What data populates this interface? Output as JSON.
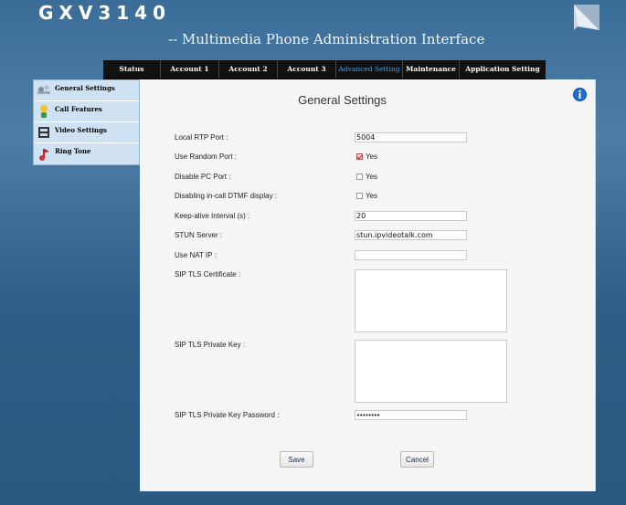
{
  "header": {
    "brand": "GXV3140",
    "subtitle": "-- Multimedia Phone Administration Interface"
  },
  "nav": {
    "tabs": [
      {
        "label": "Status",
        "active": false
      },
      {
        "label": "Account 1",
        "active": false
      },
      {
        "label": "Account 2",
        "active": false
      },
      {
        "label": "Account 3",
        "active": false
      },
      {
        "label": "Advanced Setting",
        "active": true
      },
      {
        "label": "Maintenance",
        "active": false
      },
      {
        "label": "Application Setting",
        "active": false
      }
    ]
  },
  "sidebar": {
    "items": [
      {
        "label": "General Settings",
        "icon": "settings-wrench-icon"
      },
      {
        "label": "Call Features",
        "icon": "call-features-icon"
      },
      {
        "label": "Video Settings",
        "icon": "video-film-icon"
      },
      {
        "label": "Ring Tone",
        "icon": "ring-tone-note-icon"
      }
    ]
  },
  "main": {
    "title": "General Settings",
    "fields": {
      "local_rtp_port": {
        "label": "Local RTP Port :",
        "value": "5004"
      },
      "use_random_port": {
        "label": "Use Random Port :",
        "option": "Yes",
        "checked": true
      },
      "disable_pc_port": {
        "label": "Disable PC Port :",
        "option": "Yes",
        "checked": false
      },
      "disable_dtmf": {
        "label": "Disabling in-call DTMF display :",
        "option": "Yes",
        "checked": false
      },
      "keep_alive": {
        "label": "Keep-alive Interval (s) :",
        "value": "20"
      },
      "stun_server": {
        "label": "STUN Server :",
        "value": "stun.ipvideotalk.com"
      },
      "use_nat_ip": {
        "label": "Use NAT IP :",
        "value": ""
      },
      "sip_tls_cert": {
        "label": "SIP TLS Certificate :",
        "value": ""
      },
      "sip_tls_key": {
        "label": "SIP TLS Private Key :",
        "value": ""
      },
      "sip_tls_key_password": {
        "label": "SIP TLS Private Key Password :",
        "value": "••••••••"
      }
    },
    "buttons": {
      "save": "Save",
      "cancel": "Cancel"
    }
  },
  "colors": {
    "background": "#3a6d98",
    "nav_bar": "#111111",
    "active_tab": "#3aa0e8",
    "sidebar": "#cfe2f4",
    "panel": "#f5f5f5"
  }
}
